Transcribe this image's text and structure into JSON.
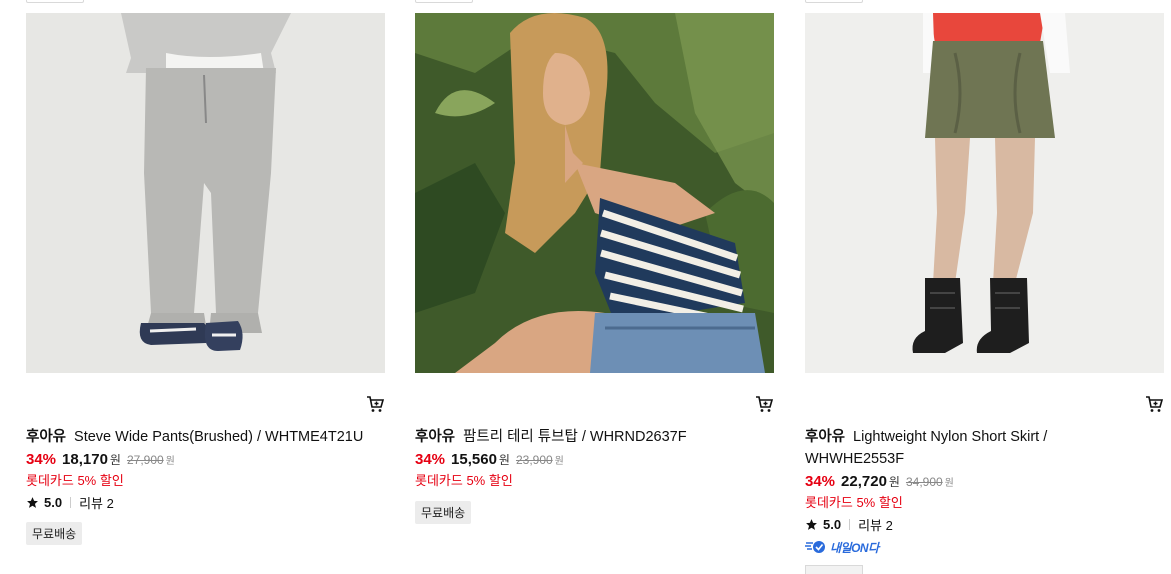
{
  "products": [
    {
      "brand": "후아유",
      "name": "Steve Wide Pants(Brushed) / WHTME4T21U",
      "discount": "34%",
      "price": "18,170",
      "price_unit": "원",
      "original_price": "27,900",
      "original_unit": "원",
      "card_benefit": "롯데카드 5% 할인",
      "rating": "5.0",
      "review_label": "리뷰 2",
      "badge": "무료배송",
      "icon": "cart-icon"
    },
    {
      "brand": "후아유",
      "name": "팜트리 테리 튜브탑 / WHRND2637F",
      "discount": "34%",
      "price": "15,560",
      "price_unit": "원",
      "original_price": "23,900",
      "original_unit": "원",
      "card_benefit": "롯데카드 5% 할인",
      "badge": "무료배송",
      "icon": "cart-icon"
    },
    {
      "brand": "후아유",
      "name": "Lightweight Nylon Short Skirt / WHWHE2553F",
      "discount": "34%",
      "price": "22,720",
      "price_unit": "원",
      "original_price": "34,900",
      "original_unit": "원",
      "card_benefit": "롯데카드 5% 할인",
      "rating": "5.0",
      "review_label": "리뷰 2",
      "delivery_badge": "내일ON다",
      "icon": "cart-icon"
    }
  ],
  "colors": {
    "discount": "#e60012",
    "delivery": "#2a6bdc",
    "badge_bg": "#ececec"
  }
}
